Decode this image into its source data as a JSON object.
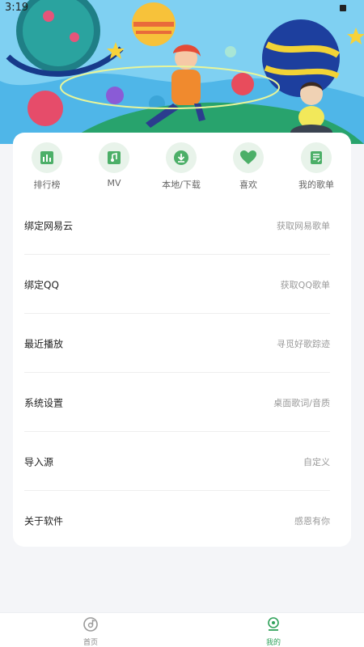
{
  "status_bar": {
    "time": "3:19"
  },
  "quick_actions": [
    {
      "label": "排行榜",
      "icon": "chart-bars-icon"
    },
    {
      "label": "MV",
      "icon": "music-note-icon"
    },
    {
      "label": "本地/下载",
      "icon": "download-icon"
    },
    {
      "label": "喜欢",
      "icon": "heart-icon"
    },
    {
      "label": "我的歌单",
      "icon": "playlist-icon"
    }
  ],
  "menu_items": [
    {
      "title": "绑定网易云",
      "value": "获取网易歌单"
    },
    {
      "title": "绑定QQ",
      "value": "获取QQ歌单"
    },
    {
      "title": "最近播放",
      "value": "寻觅好歌踪迹"
    },
    {
      "title": "系统设置",
      "value": "桌面歌词/音质"
    },
    {
      "title": "导入源",
      "value": "自定义"
    },
    {
      "title": "关于软件",
      "value": "感恩有你"
    }
  ],
  "bottom_nav": {
    "home_label": "首页",
    "mine_label": "我的",
    "active": "我的"
  },
  "colors": {
    "accent": "#2fa15a",
    "icon_bg": "#e8f3ea",
    "page_bg": "#f4f5f8"
  }
}
